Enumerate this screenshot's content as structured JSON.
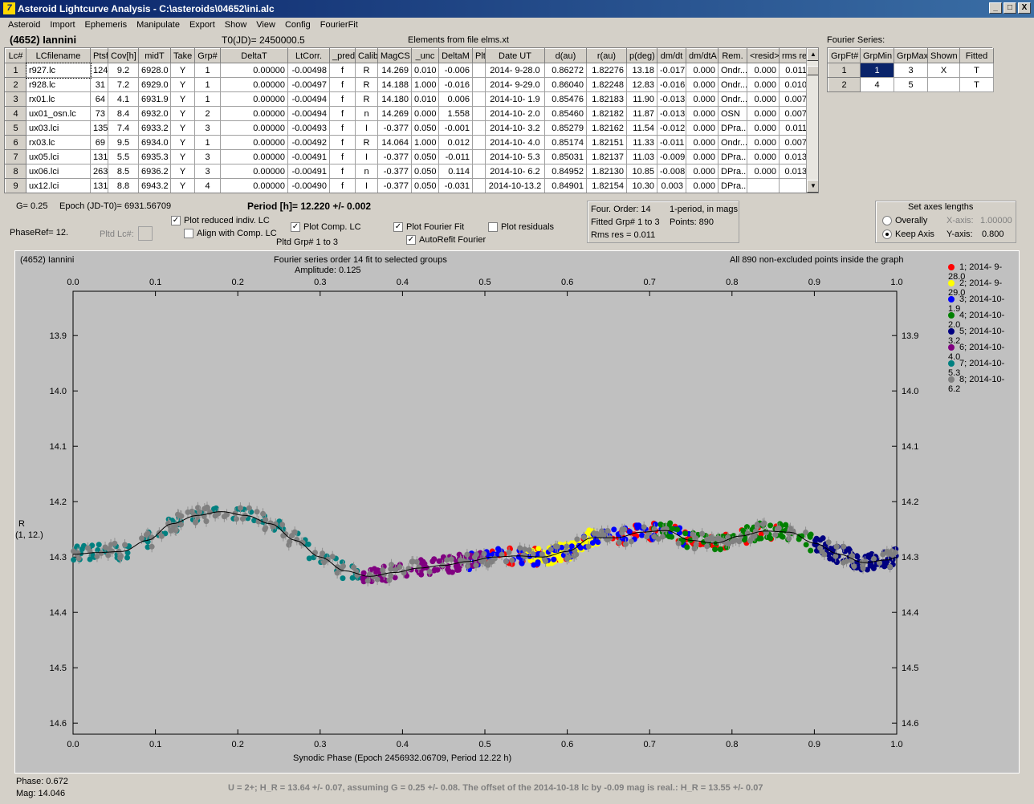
{
  "window": {
    "title": "Asteroid Lightcurve Analysis - C:\\asteroids\\04652\\ini.alc",
    "min": "_",
    "max": "□",
    "close": "X",
    "icon": "7"
  },
  "menu": [
    "Asteroid",
    "Import",
    "Ephemeris",
    "Manipulate",
    "Export",
    "Show",
    "View",
    "Config",
    "FourierFit"
  ],
  "header": {
    "asteroid": "(4652) Iannini",
    "t0": "T0(JD)= 2450000.5",
    "elements": "Elements from file elms.xt",
    "fourier_label": "Fourier Series:"
  },
  "lc_table": {
    "columns": [
      "Lc#",
      "LCfilename",
      "Ptsf",
      "Cov[h]",
      "midT",
      "Take",
      "Grp#",
      "DeltaT",
      "LtCorr.",
      "_pred.",
      "Calib.",
      "MagCS",
      "_unc",
      "DeltaM",
      "Plt",
      "Date UT",
      "d(au)",
      "r(au)",
      "p(deg)",
      "dm/dt",
      "dm/dtA",
      "Rem.",
      "<resid>",
      "rms res"
    ],
    "rows": [
      [
        "1",
        "r927.lc",
        "124",
        "9.2",
        "6928.0",
        "Y",
        "1",
        "0.00000",
        "-0.00498",
        "f",
        "R",
        "14.269",
        "0.010",
        "-0.006",
        "",
        "2014- 9-28.0",
        "0.86272",
        "1.82276",
        "13.18",
        "-0.017",
        "0.000",
        "Ondr...",
        "0.000",
        "0.011"
      ],
      [
        "2",
        "r928.lc",
        "31",
        "7.2",
        "6929.0",
        "Y",
        "1",
        "0.00000",
        "-0.00497",
        "f",
        "R",
        "14.188",
        "1.000",
        "-0.016",
        "",
        "2014- 9-29.0",
        "0.86040",
        "1.82248",
        "12.83",
        "-0.016",
        "0.000",
        "Ondr...",
        "0.000",
        "0.010"
      ],
      [
        "3",
        "rx01.lc",
        "64",
        "4.1",
        "6931.9",
        "Y",
        "1",
        "0.00000",
        "-0.00494",
        "f",
        "R",
        "14.180",
        "0.010",
        "0.006",
        "",
        "2014-10- 1.9",
        "0.85476",
        "1.82183",
        "11.90",
        "-0.013",
        "0.000",
        "Ondr...",
        "0.000",
        "0.007"
      ],
      [
        "4",
        "ux01_osn.lc",
        "73",
        "8.4",
        "6932.0",
        "Y",
        "2",
        "0.00000",
        "-0.00494",
        "f",
        "n",
        "14.269",
        "0.000",
        "1.558",
        "",
        "2014-10- 2.0",
        "0.85460",
        "1.82182",
        "11.87",
        "-0.013",
        "0.000",
        "OSN",
        "0.000",
        "0.007"
      ],
      [
        "5",
        "ux03.lci",
        "135",
        "7.4",
        "6933.2",
        "Y",
        "3",
        "0.00000",
        "-0.00493",
        "f",
        "I",
        "-0.377",
        "0.050",
        "-0.001",
        "",
        "2014-10- 3.2",
        "0.85279",
        "1.82162",
        "11.54",
        "-0.012",
        "0.000",
        "DPra...",
        "0.000",
        "0.011"
      ],
      [
        "6",
        "rx03.lc",
        "69",
        "9.5",
        "6934.0",
        "Y",
        "1",
        "0.00000",
        "-0.00492",
        "f",
        "R",
        "14.064",
        "1.000",
        "0.012",
        "",
        "2014-10- 4.0",
        "0.85174",
        "1.82151",
        "11.33",
        "-0.011",
        "0.000",
        "Ondr...",
        "0.000",
        "0.007"
      ],
      [
        "7",
        "ux05.lci",
        "131",
        "5.5",
        "6935.3",
        "Y",
        "3",
        "0.00000",
        "-0.00491",
        "f",
        "I",
        "-0.377",
        "0.050",
        "-0.011",
        "",
        "2014-10- 5.3",
        "0.85031",
        "1.82137",
        "11.03",
        "-0.009",
        "0.000",
        "DPra...",
        "0.000",
        "0.013"
      ],
      [
        "8",
        "ux06.lci",
        "263",
        "8.5",
        "6936.2",
        "Y",
        "3",
        "0.00000",
        "-0.00491",
        "f",
        "n",
        "-0.377",
        "0.050",
        "0.114",
        "",
        "2014-10- 6.2",
        "0.84952",
        "1.82130",
        "10.85",
        "-0.008",
        "0.000",
        "DPra...",
        "0.000",
        "0.013"
      ],
      [
        "9",
        "ux12.lci",
        "131",
        "8.8",
        "6943.2",
        "Y",
        "4",
        "0.00000",
        "-0.00490",
        "f",
        "I",
        "-0.377",
        "0.050",
        "-0.031",
        "",
        "2014-10-13.2",
        "0.84901",
        "1.82154",
        "10.30",
        "0.003",
        "0.000",
        "DPra...",
        "",
        ""
      ]
    ]
  },
  "fourier_table": {
    "columns": [
      "GrpFt#",
      "GrpMin",
      "GrpMax",
      "Shown",
      "Fitted"
    ],
    "rows": [
      [
        "1",
        "1",
        "3",
        "X",
        "T"
      ],
      [
        "2",
        "4",
        "5",
        "",
        "T"
      ]
    ]
  },
  "controls": {
    "g": "G= 0.25",
    "epoch": "Epoch (JD-T0)= 6931.56709",
    "period": "Period [h]= 12.220 +/- 0.002",
    "phaseref": "PhaseRef= 12.",
    "pltd_lc": "Pltd Lc#:",
    "plot_reduced": "Plot reduced indiv. LC",
    "align_comp": "Align with Comp. LC",
    "plot_comp": "Plot Comp. LC",
    "pltd_grp": "Pltd Grp#  1   to   3",
    "plot_fourier": "Plot Fourier Fit",
    "autorefit": "AutoRefit Fourier",
    "plot_resid": "Plot residuals",
    "four_order": "Four. Order: 14",
    "one_period": "1-period, in mags",
    "fitted_grp": "Fitted Grp# 1 to 3",
    "points": "Points: 890",
    "rms": "Rms res     = 0.011",
    "axes_title": "Set axes lengths",
    "overally": "Overally",
    "keep_axis": "Keep Axis",
    "xaxis_label": "X-axis:",
    "xaxis_val": "1.00000",
    "yaxis_label": "Y-axis:",
    "yaxis_val": "0.800"
  },
  "plot": {
    "name": "(4652) Iannini",
    "title1": "Fourier series order 14 fit to selected groups",
    "title2": "Amplitude: 0.125",
    "note": "All 890 non-excluded points inside the graph",
    "xlabel": "Synodic Phase (Epoch 2456932.06709, Period 12.22 h)",
    "ylabel1": "R",
    "ylabel2": "(1, 12.)",
    "legend": [
      {
        "label": "1; 2014- 9-28.0",
        "color": "#ff0000"
      },
      {
        "label": "2; 2014- 9-29.0",
        "color": "#ffff00"
      },
      {
        "label": "3; 2014-10- 1.9",
        "color": "#0000ff"
      },
      {
        "label": "4; 2014-10- 2.0",
        "color": "#008000"
      },
      {
        "label": "5; 2014-10- 3.2",
        "color": "#000080"
      },
      {
        "label": "6; 2014-10- 4.0",
        "color": "#800080"
      },
      {
        "label": "7; 2014-10- 5.3",
        "color": "#008080"
      },
      {
        "label": "8; 2014-10- 6.2",
        "color": "#808080"
      }
    ]
  },
  "chart_data": {
    "type": "scatter",
    "title": "Fourier series order 14 fit to selected groups",
    "subtitle": "Amplitude: 0.125",
    "xlabel": "Synodic Phase (Epoch 2456932.06709, Period 12.22 h)",
    "ylabel": "R (1, 12.)",
    "xlim": [
      0,
      1
    ],
    "ylim": [
      14.62,
      13.82
    ],
    "x_ticks": [
      0.0,
      0.1,
      0.2,
      0.3,
      0.4,
      0.5,
      0.6,
      0.7,
      0.8,
      0.9,
      1.0
    ],
    "y_ticks": [
      13.9,
      14.0,
      14.1,
      14.2,
      14.3,
      14.4,
      14.5,
      14.6
    ],
    "fit": {
      "x": [
        0.0,
        0.03,
        0.06,
        0.09,
        0.12,
        0.15,
        0.18,
        0.21,
        0.24,
        0.27,
        0.3,
        0.33,
        0.36,
        0.39,
        0.42,
        0.45,
        0.48,
        0.51,
        0.54,
        0.57,
        0.6,
        0.63,
        0.66,
        0.69,
        0.72,
        0.75,
        0.78,
        0.81,
        0.84,
        0.87,
        0.9,
        0.93,
        0.96,
        0.99,
        1.0
      ],
      "y": [
        14.295,
        14.292,
        14.29,
        14.27,
        14.24,
        14.225,
        14.218,
        14.225,
        14.24,
        14.27,
        14.3,
        14.325,
        14.335,
        14.328,
        14.32,
        14.315,
        14.308,
        14.3,
        14.298,
        14.3,
        14.29,
        14.265,
        14.265,
        14.255,
        14.252,
        14.27,
        14.275,
        14.262,
        14.253,
        14.255,
        14.275,
        14.295,
        14.31,
        14.305,
        14.3
      ]
    },
    "groups": [
      {
        "name": "1; 2014- 9-28.0",
        "x_range": [
          0.5,
          0.87
        ],
        "color": "#ff0000"
      },
      {
        "name": "2; 2014- 9-29.0",
        "x_range": [
          0.55,
          0.64
        ],
        "color": "#ffff00"
      },
      {
        "name": "3; 2014-10- 1.9",
        "x_range": [
          0.48,
          0.75
        ],
        "color": "#0000ff"
      },
      {
        "name": "4; 2014-10- 2.0",
        "x_range": [
          0.7,
          0.9
        ],
        "color": "#008000"
      },
      {
        "name": "5; 2014-10- 3.2",
        "x_range": [
          0.9,
          1.0
        ],
        "color": "#000080"
      },
      {
        "name": "6; 2014-10- 4.0",
        "x_range": [
          0.35,
          0.5
        ],
        "color": "#800080"
      },
      {
        "name": "7; 2014-10- 5.3",
        "x_range": [
          0.0,
          0.35
        ],
        "color": "#008080"
      },
      {
        "name": "8; 2014-10- 6.2",
        "x_range": [
          0.0,
          1.0
        ],
        "color": "#808080"
      }
    ]
  },
  "status": {
    "phase": "Phase:  0.672",
    "mag": "Mag:    14.046",
    "note": "U = 2+; H_R = 13.64 +/- 0.07, assuming G = 0.25 +/- 0.08.  The offset of the 2014-10-18 lc by -0.09 mag is real.: H_R = 13.55 +/- 0.07"
  }
}
